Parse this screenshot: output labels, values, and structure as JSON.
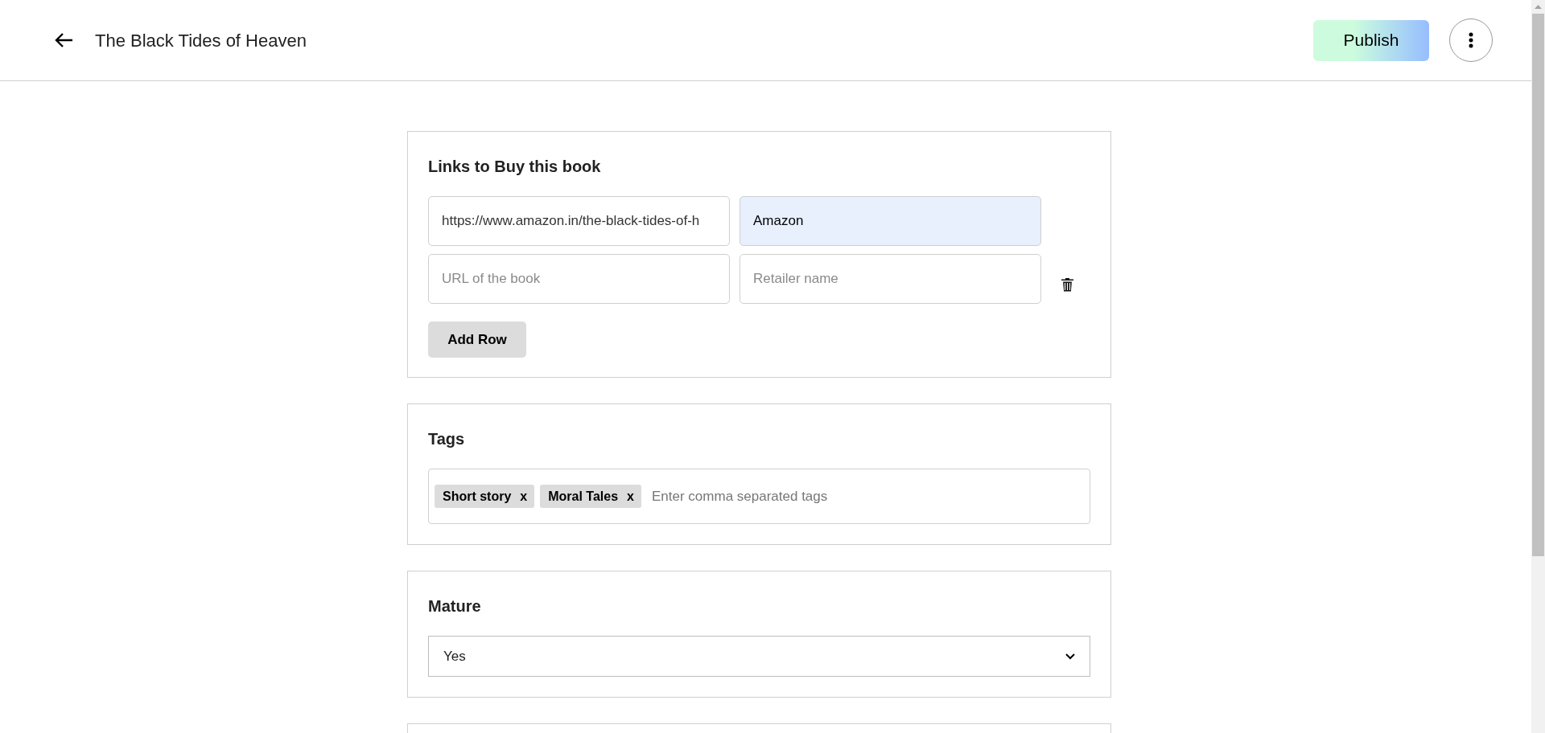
{
  "header": {
    "title": "The Black Tides of Heaven",
    "publish_button": "Publish"
  },
  "links_section": {
    "heading": "Links to Buy this book",
    "rows": [
      {
        "url": {
          "value": "https://www.amazon.in/the-black-tides-of-h"
        },
        "retailer": {
          "value": "Amazon",
          "autofilled": true
        },
        "removable": false
      },
      {
        "url": {
          "placeholder": "URL of the book"
        },
        "retailer": {
          "placeholder": "Retailer name",
          "autofilled": false
        },
        "removable": true
      }
    ],
    "add_button": "Add Row"
  },
  "tags_section": {
    "heading": "Tags",
    "tags": [
      {
        "label": "Short story",
        "remove": "x"
      },
      {
        "label": "Moral Tales",
        "remove": "x"
      }
    ],
    "placeholder": "Enter comma separated tags"
  },
  "mature_section": {
    "heading": "Mature",
    "value": "Yes"
  }
}
